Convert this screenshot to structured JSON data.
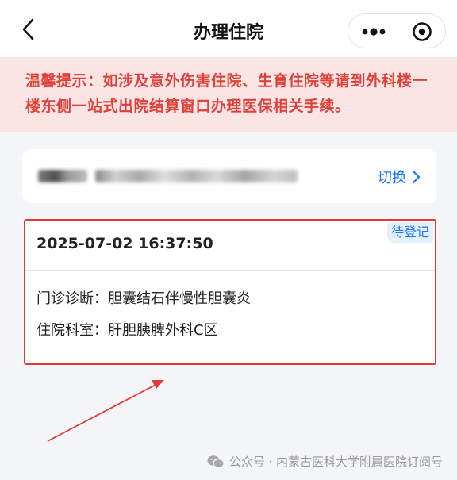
{
  "header": {
    "title": "办理住院",
    "back_icon": "chevron-left-icon",
    "more_icon": "more-dots-icon",
    "close_icon": "target-circle-icon"
  },
  "notice": {
    "text": "温馨提示：如涉及意外伤害住院、生育住院等请到外科楼一楼东侧一站式出院结算窗口办理医保相关手续。"
  },
  "patient": {
    "switch_label": "切换",
    "switch_icon": "chevron-right-icon"
  },
  "record": {
    "status": "待登记",
    "time": "2025-07-02 16:37:50",
    "diagnosis_label": "门诊诊断：",
    "diagnosis": "胆囊结石伴慢性胆囊炎",
    "dept_label": "住院科室：",
    "dept": "肝胆胰脾外科C区"
  },
  "watermark": {
    "text": "公众号 · 内蒙古医科大学附属医院订阅号",
    "icon": "wechat-icon"
  },
  "colors": {
    "accent": "#1677ff",
    "notice_text": "#e0403a",
    "notice_bg": "#fbe5e4",
    "highlight": "#e53935"
  }
}
